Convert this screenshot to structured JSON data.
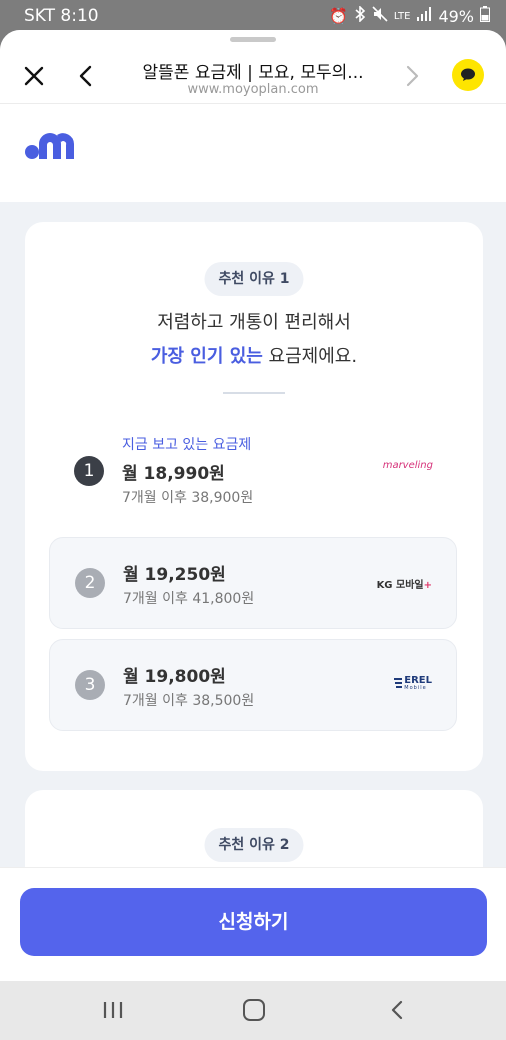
{
  "status_bar": {
    "carrier_time": "SKT 8:10",
    "network": "LTE",
    "battery": "49%",
    "icons": [
      "alarm-icon",
      "bluetooth-icon",
      "mute-icon",
      "signal-icon",
      "battery-icon"
    ]
  },
  "browser": {
    "title": "알뜰폰 요금제 | 모요, 모두의...",
    "url": "www.moyoplan.com",
    "icons": [
      "close-icon",
      "back-icon",
      "forward-icon",
      "kakao-chat-icon"
    ]
  },
  "site": {
    "logo": "moyo-logo"
  },
  "reason1": {
    "pill": "추천 이유 1",
    "headline_line1": "저렴하고 개통이 편리해서",
    "headline_accent": "가장 인기 있는",
    "headline_rest": " 요금제에요."
  },
  "plans": [
    {
      "rank": "1",
      "current_label": "지금 보고 있는 요금제",
      "price": "월 18,990원",
      "after": "7개월 이후 38,900원",
      "carrier": "marveling"
    },
    {
      "rank": "2",
      "price": "월 19,250원",
      "after": "7개월 이후 41,800원",
      "carrier": "KG 모바일",
      "carrier_mark": "+"
    },
    {
      "rank": "3",
      "price": "월 19,800원",
      "after": "7개월 이후 38,500원",
      "carrier": "EREL",
      "carrier_sub": "Mobile"
    }
  ],
  "reason2": {
    "pill": "추천 이유 2"
  },
  "cta": {
    "label": "신청하기"
  },
  "nav": {
    "icons": [
      "recent-apps-icon",
      "home-icon",
      "back-icon"
    ]
  },
  "colors": {
    "accent": "#4a5ee0",
    "cta": "#5464ec",
    "kakao": "#fee500"
  }
}
